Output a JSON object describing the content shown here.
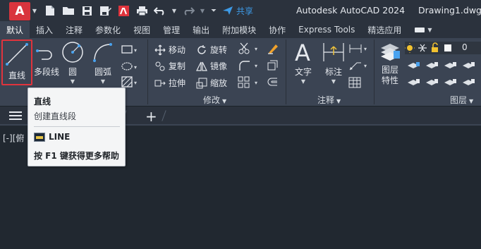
{
  "titlebar": {
    "logo_letter": "A",
    "share_label": "共享",
    "app_title": "Autodesk AutoCAD 2024",
    "document": "Drawing1.dwg"
  },
  "tabs": [
    {
      "label": "默认",
      "active": true
    },
    {
      "label": "插入"
    },
    {
      "label": "注释"
    },
    {
      "label": "参数化"
    },
    {
      "label": "视图"
    },
    {
      "label": "管理"
    },
    {
      "label": "输出"
    },
    {
      "label": "附加模块"
    },
    {
      "label": "协作"
    },
    {
      "label": "Express Tools"
    },
    {
      "label": "精选应用"
    }
  ],
  "ribbon": {
    "draw": {
      "line": "直线",
      "polyline": "多段线",
      "circle": "圆",
      "arc": "圆弧"
    },
    "modify": {
      "panel_label": "修改",
      "move": "移动",
      "rotate": "旋转",
      "copy": "复制",
      "mirror": "镜像",
      "stretch": "拉伸",
      "scale": "缩放"
    },
    "annotation": {
      "panel_label": "注释",
      "text": "文字",
      "dimension": "标注"
    },
    "layers": {
      "panel_label": "图层",
      "properties_line1": "图层",
      "properties_line2": "特性",
      "current_layer": "0"
    }
  },
  "viewport": {
    "label": "[-][俯"
  },
  "tooltip": {
    "title": "直线",
    "description": "创建直线段",
    "command": "LINE",
    "help": "按 F1 键获得更多帮助"
  },
  "colors": {
    "accent_red": "#e0343d",
    "share_blue": "#3d9ae6",
    "ribbon_bg": "#3b4453",
    "title_bg": "#2b323d"
  }
}
